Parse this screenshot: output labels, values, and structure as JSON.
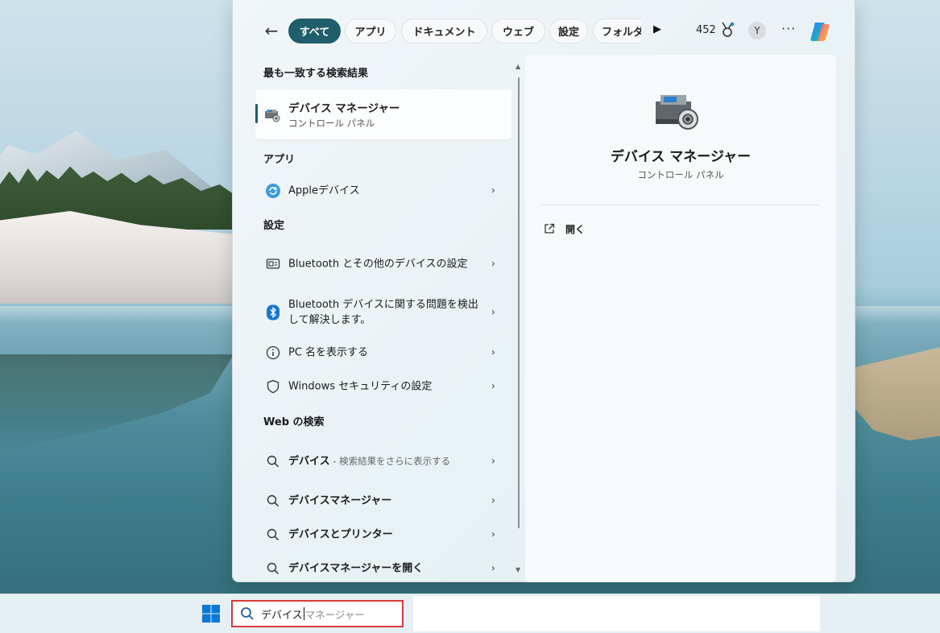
{
  "filters": {
    "chips": [
      {
        "label": "すべて",
        "active": true
      },
      {
        "label": "アプリ"
      },
      {
        "label": "ドキュメント"
      },
      {
        "label": "ウェブ"
      },
      {
        "label": "設定"
      },
      {
        "label": "フォルダ"
      }
    ],
    "points": "452",
    "avatar_initial": "Y",
    "more_menu": "···"
  },
  "best_match": {
    "heading": "最も一致する検索結果",
    "title": "デバイス マネージャー",
    "subtitle": "コントロール パネル"
  },
  "apps": {
    "heading": "アプリ",
    "items": [
      {
        "label": "Appleデバイス"
      }
    ]
  },
  "settings": {
    "heading": "設定",
    "items": [
      {
        "label": "Bluetooth とその他のデバイスの設定"
      },
      {
        "label": "Bluetooth デバイスに関する問題を検出して解決します。"
      },
      {
        "label": "PC 名を表示する"
      },
      {
        "label": "Windows セキュリティの設定"
      }
    ]
  },
  "web": {
    "heading": "Web の検索",
    "items": [
      {
        "label": "デバイス",
        "hint": " - 検索結果をさらに表示する"
      },
      {
        "label": "デバイスマネージャー"
      },
      {
        "label": "デバイスとプリンター"
      },
      {
        "label": "デバイスマネージャーを開く"
      }
    ]
  },
  "preview": {
    "title": "デバイス マネージャー",
    "subtitle": "コントロール パネル",
    "open_label": "開く"
  },
  "taskbar": {
    "search_typed": "デバイス",
    "search_suggestion": "マネージャー"
  },
  "colors": {
    "accent": "#1f5e6a",
    "highlight_border": "#d93a3a"
  }
}
